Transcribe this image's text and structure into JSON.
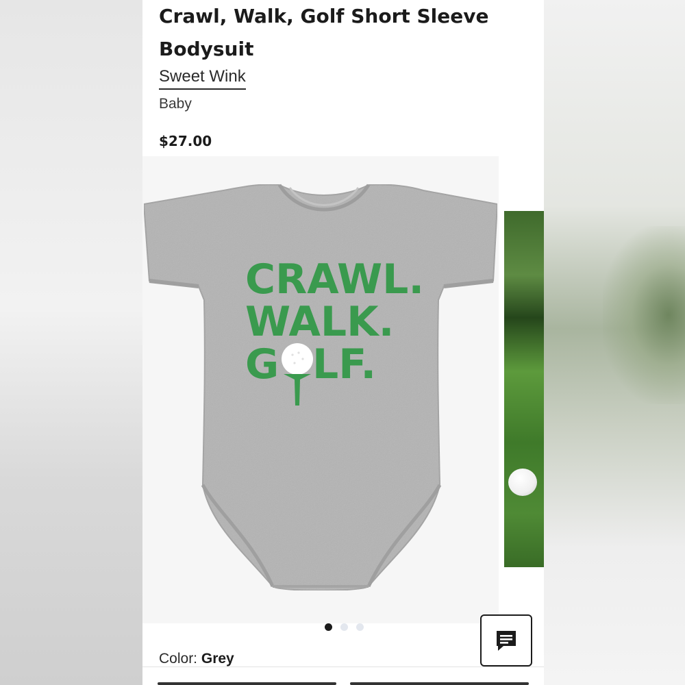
{
  "product": {
    "title": "Crawl, Walk, Golf Short Sleeve Bodysuit",
    "brand": "Sweet Wink",
    "category": "Baby",
    "price": "$27.00"
  },
  "gallery": {
    "print_lines": [
      "CRAWL.",
      "WALK.",
      "G",
      "LF."
    ],
    "slide_count": 3,
    "active_slide": 1
  },
  "options": {
    "color_label": "Color:",
    "color_value": "Grey"
  },
  "colors": {
    "print_green": "#3a9a4e",
    "fabric_grey": "#b3b3b3"
  },
  "icons": {
    "chat": "chat-icon"
  }
}
